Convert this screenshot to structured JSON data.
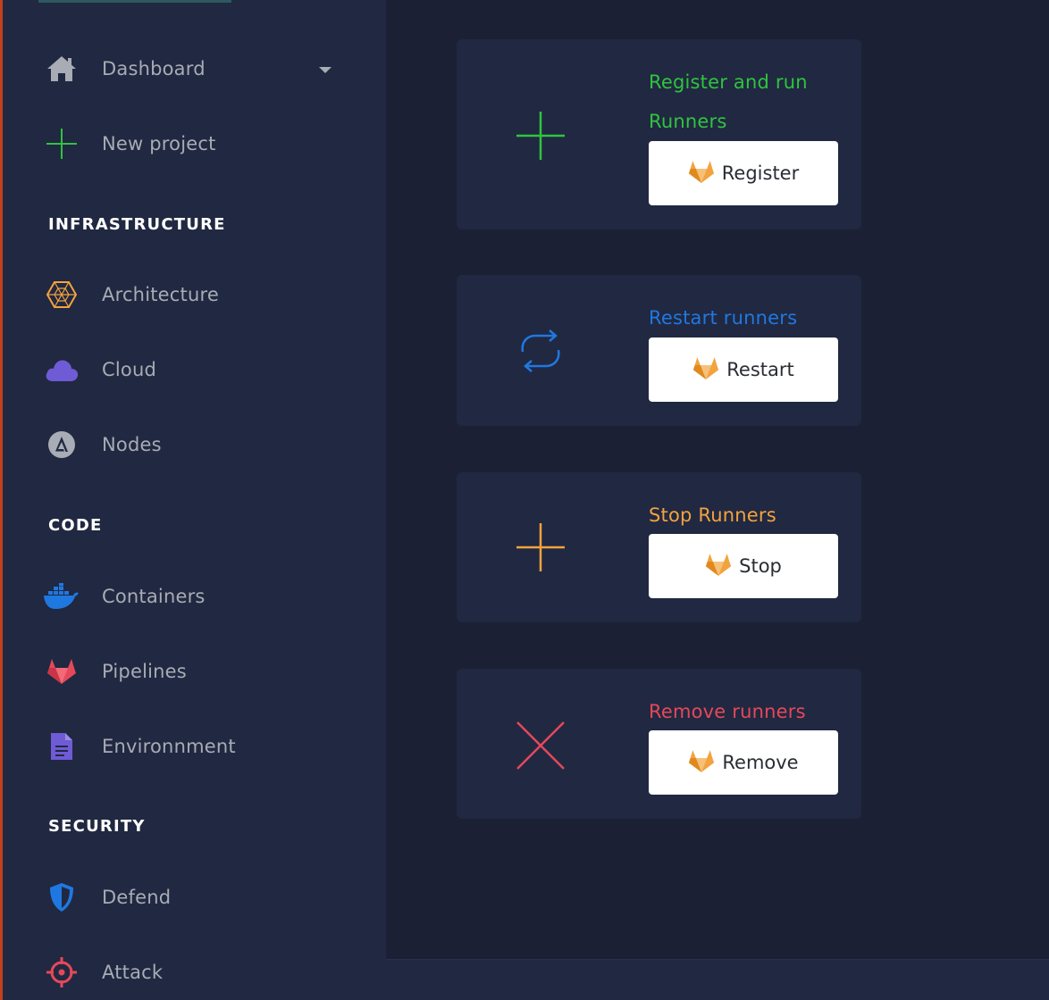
{
  "colors": {
    "sidebar_bg": "#212841",
    "main_bg": "#1b2034",
    "accent_border": "#c2401c",
    "green": "#2fc43f",
    "blue": "#1f78e0",
    "orange": "#f2a33e",
    "red": "#e5485b",
    "purple": "#6f5bd6",
    "gray": "#a7acb5"
  },
  "sidebar": {
    "dashboard": {
      "label": "Dashboard",
      "icon": "home-icon"
    },
    "new_project": {
      "label": "New project",
      "icon": "plus-icon"
    },
    "sections": {
      "infrastructure": "INFRASTRUCTURE",
      "code": "CODE",
      "security": "SECURITY"
    },
    "architecture": {
      "label": "Architecture",
      "icon": "hexagon-icon"
    },
    "cloud": {
      "label": "Cloud",
      "icon": "cloud-icon"
    },
    "nodes": {
      "label": "Nodes",
      "icon": "ansible-icon"
    },
    "containers": {
      "label": "Containers",
      "icon": "docker-icon"
    },
    "pipelines": {
      "label": "Pipelines",
      "icon": "gitlab-icon"
    },
    "environment": {
      "label": "Environnment",
      "icon": "document-icon"
    },
    "defend": {
      "label": "Defend",
      "icon": "shield-icon"
    },
    "attack": {
      "label": "Attack",
      "icon": "crosshair-icon"
    }
  },
  "cards": {
    "register": {
      "title_line1": "Register and run",
      "title_line2": "Runners",
      "button": "Register",
      "icon": "plus-icon"
    },
    "restart": {
      "title": "Restart runners",
      "button": "Restart",
      "icon": "refresh-icon"
    },
    "stop": {
      "title": "Stop Runners",
      "button": "Stop",
      "icon": "plus-icon"
    },
    "remove": {
      "title": "Remove runners",
      "button": "Remove",
      "icon": "x-icon"
    }
  }
}
